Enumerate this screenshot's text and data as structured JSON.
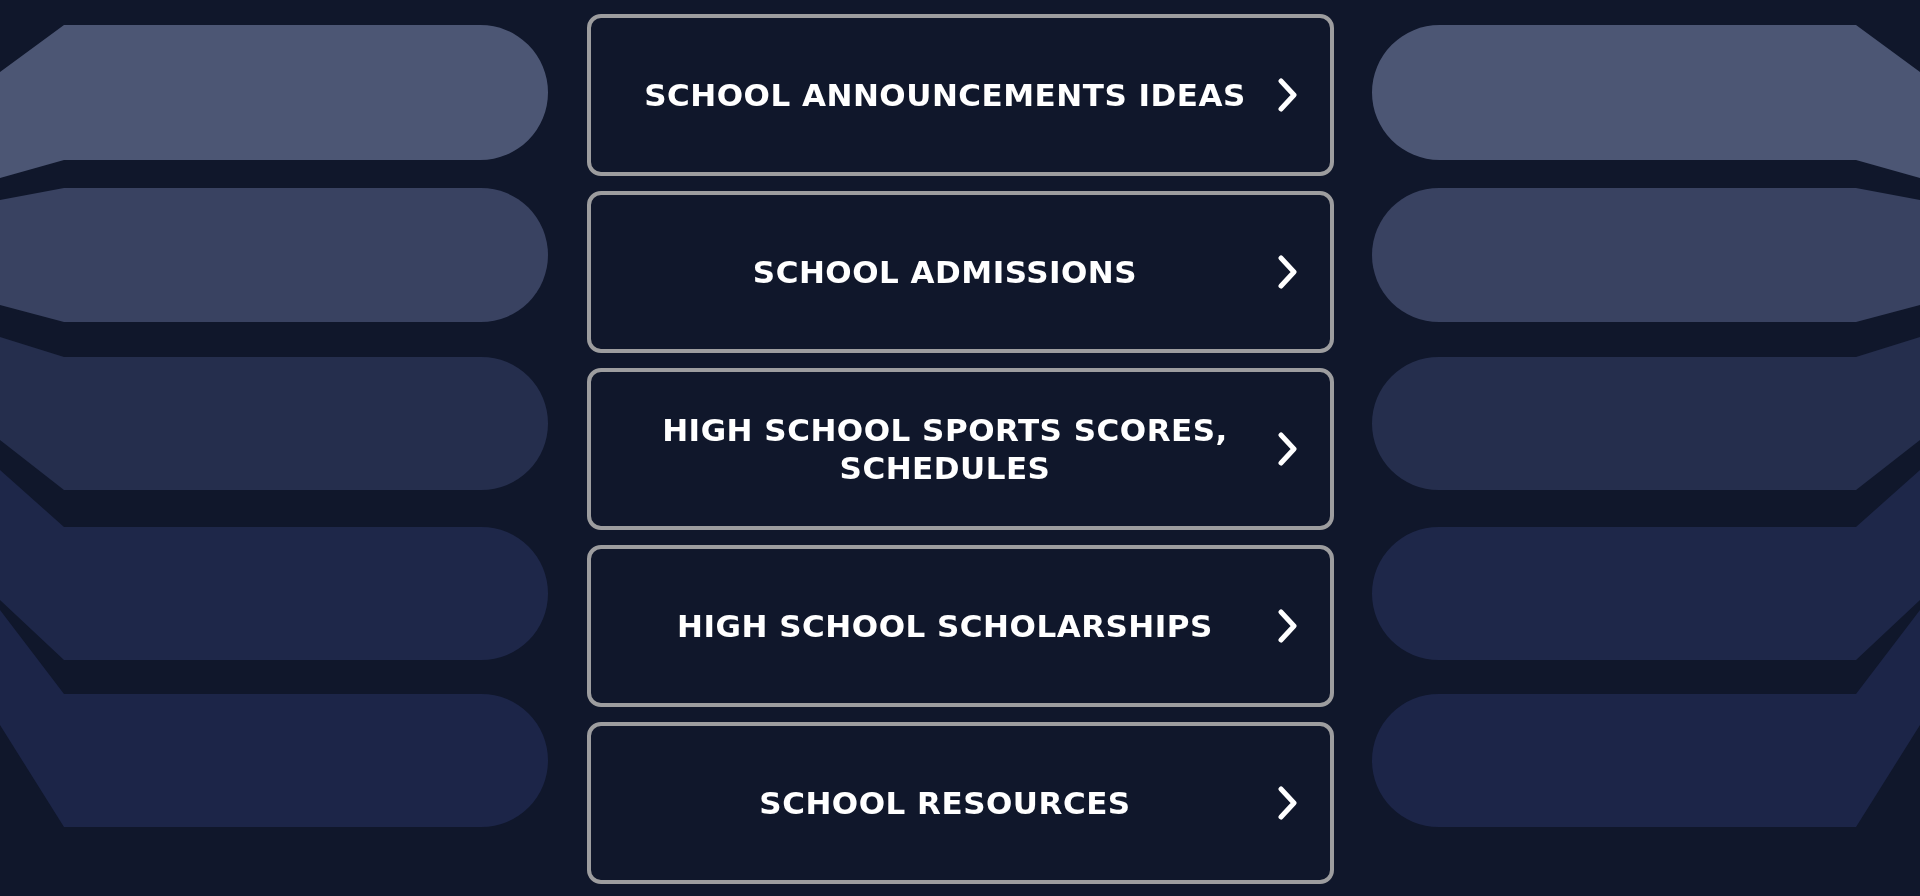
{
  "links": [
    {
      "label": "SCHOOL ANNOUNCEMENTS IDEAS"
    },
    {
      "label": "SCHOOL ADMISSIONS"
    },
    {
      "label": "HIGH SCHOOL SPORTS SCORES, SCHEDULES"
    },
    {
      "label": "HIGH SCHOOL SCHOLARSHIPS"
    },
    {
      "label": "SCHOOL RESOURCES"
    }
  ]
}
